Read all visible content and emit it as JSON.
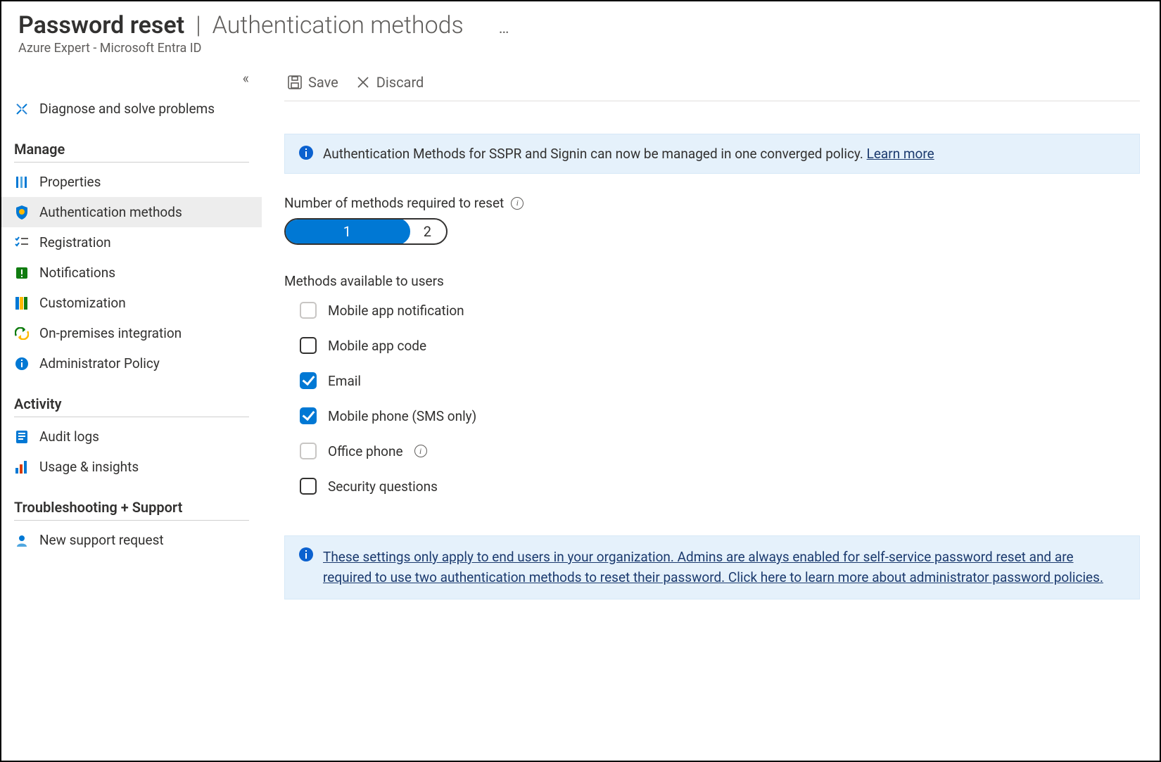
{
  "header": {
    "title_strong": "Password reset",
    "title_light": "Authentication methods",
    "subtitle": "Azure Expert - Microsoft Entra ID",
    "more": "…"
  },
  "toolbar": {
    "save_label": "Save",
    "discard_label": "Discard"
  },
  "sidebar": {
    "top_item": {
      "label": "Diagnose and solve problems"
    },
    "groups": [
      {
        "title": "Manage",
        "items": [
          {
            "key": "properties",
            "label": "Properties"
          },
          {
            "key": "auth-methods",
            "label": "Authentication methods",
            "active": true
          },
          {
            "key": "registration",
            "label": "Registration"
          },
          {
            "key": "notifications",
            "label": "Notifications"
          },
          {
            "key": "customization",
            "label": "Customization"
          },
          {
            "key": "onprem",
            "label": "On-premises integration"
          },
          {
            "key": "admin-policy",
            "label": "Administrator Policy"
          }
        ]
      },
      {
        "title": "Activity",
        "items": [
          {
            "key": "audit-logs",
            "label": "Audit logs"
          },
          {
            "key": "usage",
            "label": "Usage & insights"
          }
        ]
      },
      {
        "title": "Troubleshooting + Support",
        "items": [
          {
            "key": "support",
            "label": "New support request"
          }
        ]
      }
    ]
  },
  "info_top": {
    "text": "Authentication Methods for SSPR and Signin can now be managed in one converged policy. ",
    "link": "Learn more"
  },
  "num_methods": {
    "label": "Number of methods required to reset",
    "options": [
      "1",
      "2"
    ],
    "selected": "1"
  },
  "methods": {
    "title": "Methods available to users",
    "items": [
      {
        "label": "Mobile app notification",
        "state": "disabled-unchecked"
      },
      {
        "label": "Mobile app code",
        "state": "unchecked"
      },
      {
        "label": "Email",
        "state": "checked"
      },
      {
        "label": "Mobile phone (SMS only)",
        "state": "checked"
      },
      {
        "label": "Office phone",
        "state": "disabled-unchecked",
        "info": true
      },
      {
        "label": "Security questions",
        "state": "unchecked"
      }
    ]
  },
  "info_bottom": {
    "text": "These settings only apply to end users in your organization. Admins are always enabled for self-service password reset and are required to use two authentication methods to reset their password. Click here to learn more about administrator password policies."
  }
}
